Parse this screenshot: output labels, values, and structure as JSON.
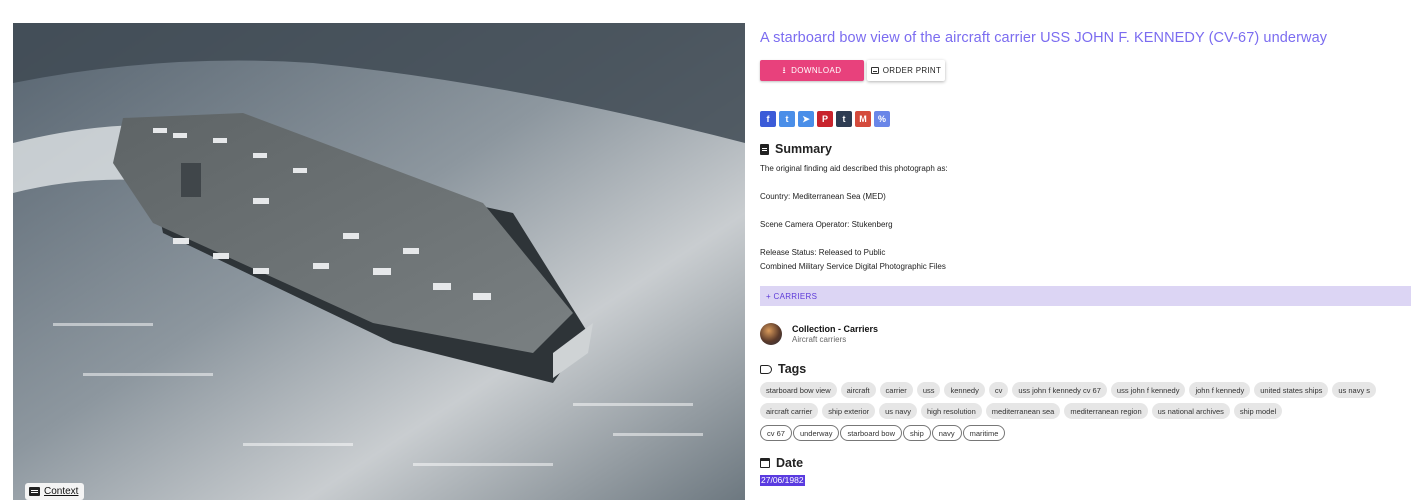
{
  "photo": {
    "context_label": "Context"
  },
  "title": "A starboard bow view of the aircraft carrier USS JOHN F. KENNEDY (CV-67) underway",
  "actions": {
    "download_label": "DOWNLOAD",
    "order_print_label": "ORDER PRINT"
  },
  "share": [
    {
      "label": "f",
      "icon": "facebook-icon",
      "color": "#3b5bd8"
    },
    {
      "label": "t",
      "icon": "twitter-icon",
      "color": "#4a8ee8"
    },
    {
      "label": "➤",
      "icon": "telegram-icon",
      "color": "#4a8ee8"
    },
    {
      "label": "P",
      "icon": "pinterest-icon",
      "color": "#c8232c"
    },
    {
      "label": "t",
      "icon": "tumblr-icon",
      "color": "#2e3c52"
    },
    {
      "label": "M",
      "icon": "gmail-icon",
      "color": "#d44b3c"
    },
    {
      "label": "%",
      "icon": "link-icon",
      "color": "#6a86e8"
    }
  ],
  "summary": {
    "heading": "Summary",
    "line1": "The original finding aid described this photograph as:",
    "line2": "Country: Mediterranean Sea (MED)",
    "line3": "Scene Camera Operator: Stukenberg",
    "line4": "Release Status: Released to Public",
    "line5": "Combined Military Service Digital Photographic Files"
  },
  "carriers_bar": "+  CARRIERS",
  "collection": {
    "title": "Collection - Carriers",
    "subtitle": "Aircraft carriers"
  },
  "tags": {
    "heading": "Tags",
    "row1": [
      "starboard bow view",
      "aircraft",
      "carrier",
      "uss",
      "kennedy",
      "cv",
      "uss john f kennedy cv 67",
      "uss john f kennedy",
      "john f kennedy",
      "united states ships",
      "us navy s"
    ],
    "row2": [
      "aircraft carrier",
      "ship exterior",
      "us navy",
      "high resolution",
      "mediterranean sea",
      "mediterranean region",
      "us national archives",
      "ship model"
    ],
    "row3": [
      "cv 67",
      "underway",
      "starboard bow",
      "ship",
      "navy",
      "maritime"
    ]
  },
  "date": {
    "heading": "Date",
    "value": "27/06/1982"
  }
}
